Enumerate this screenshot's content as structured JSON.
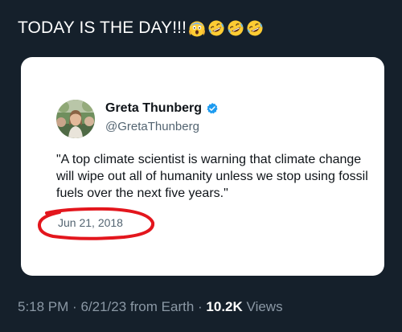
{
  "post": {
    "text": "TODAY IS THE DAY!!!",
    "emojis": [
      "face-screaming-in-fear-icon",
      "rolling-on-the-floor-laughing-icon",
      "rolling-on-the-floor-laughing-icon",
      "rolling-on-the-floor-laughing-icon"
    ]
  },
  "quoted_tweet": {
    "name": "Greta Thunberg",
    "verified_icon": "verified-badge-icon",
    "verified_color": "#1d9bf0",
    "handle": "@GretaThunberg",
    "text": "\"A top climate scientist is warning that climate change will wipe out all of humanity unless we stop using fossil fuels over the next five years.\"",
    "date": "Jun 21, 2018",
    "annotation_color": "#e3161d"
  },
  "meta": {
    "time": "5:18 PM",
    "separator": "·",
    "date": "6/21/23",
    "source": "from Earth",
    "views_count": "10.2K",
    "views_label": "Views"
  },
  "colors": {
    "background": "#15202b",
    "card": "#ffffff",
    "muted_text": "#8b98a5"
  }
}
